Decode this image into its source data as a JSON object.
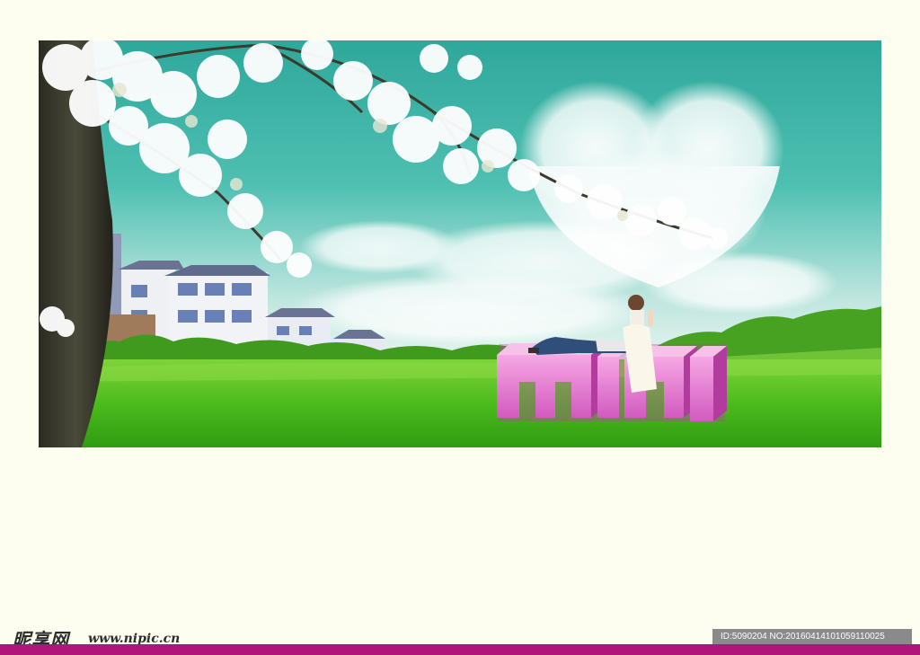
{
  "scene": {
    "sign_text": "mini",
    "sign_color": "#e57ad0",
    "sky_color": "#39b3a7",
    "grass_color": "#4cbb1c"
  },
  "watermark": {
    "logo": "昵享网",
    "url": "www.nipic.cn",
    "id_line": "ID:5090204 NO:20160414101059110025"
  },
  "accent": {
    "bottom_bar_color": "#b0167a"
  }
}
